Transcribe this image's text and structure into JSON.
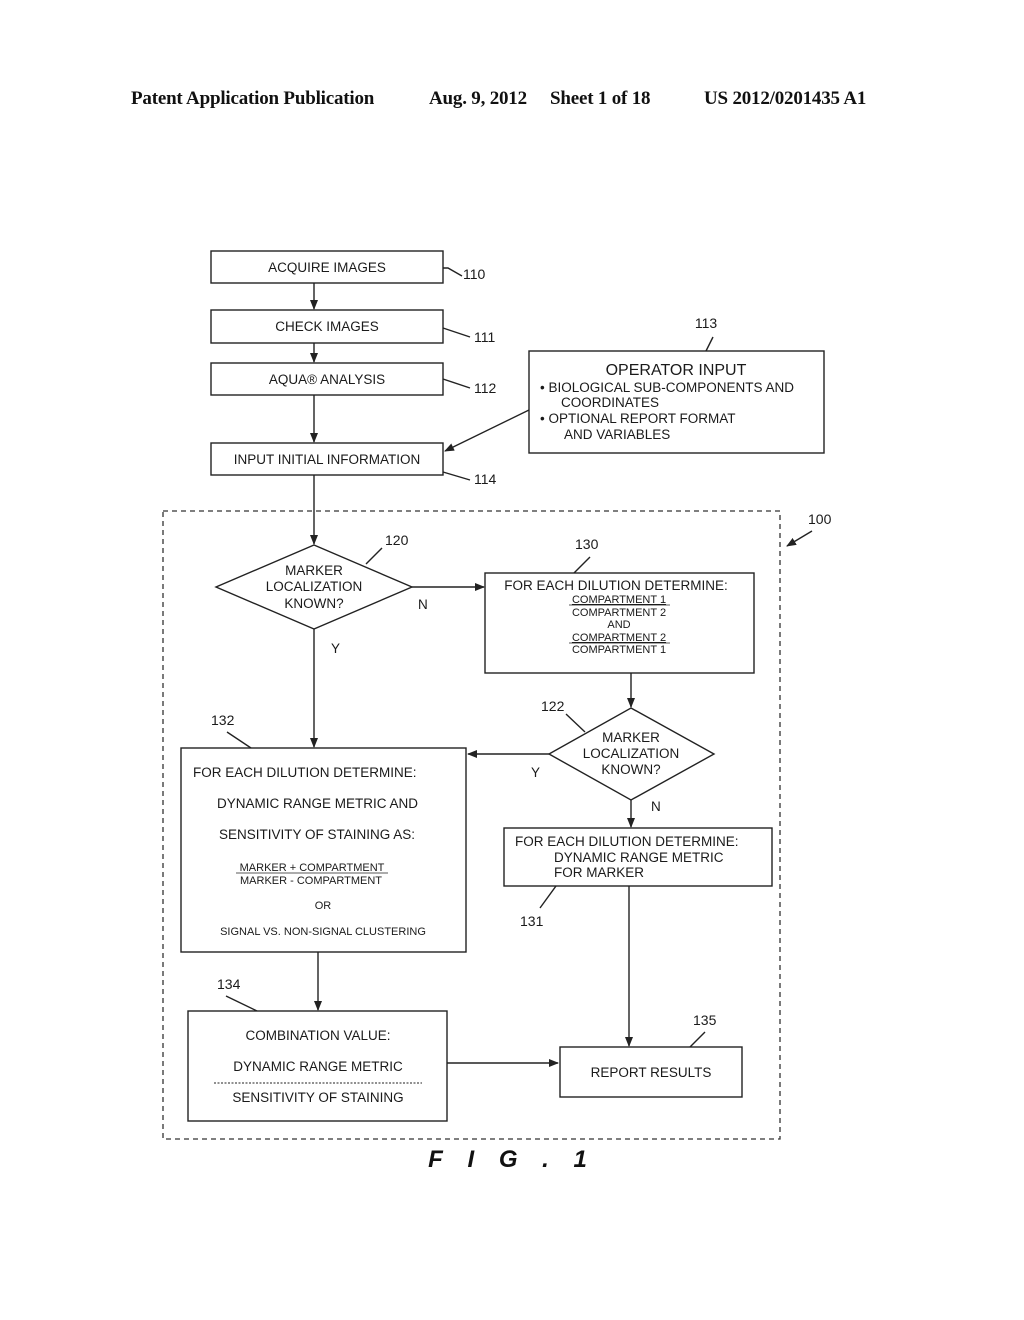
{
  "header": {
    "publication": "Patent Application Publication",
    "date": "Aug. 9, 2012",
    "sheet": "Sheet 1 of 18",
    "number": "US 2012/0201435 A1"
  },
  "figure": {
    "caption": "F I G . 1",
    "boundary_ref": "100",
    "nodes": {
      "acquire": {
        "ref": "110",
        "label": "ACQUIRE IMAGES"
      },
      "check": {
        "ref": "111",
        "label": "CHECK IMAGES"
      },
      "aqua": {
        "ref": "112",
        "label": "AQUA® ANALYSIS"
      },
      "operator": {
        "ref": "113",
        "title": "OPERATOR INPUT",
        "lines": [
          "• BIOLOGICAL SUB-COMPONENTS AND",
          "COORDINATES",
          "• OPTIONAL REPORT FORMAT",
          "AND VARIABLES"
        ]
      },
      "input_info": {
        "ref": "114",
        "label": "INPUT INITIAL INFORMATION"
      },
      "decision1": {
        "ref": "120",
        "lines": [
          "MARKER",
          "LOCALIZATION",
          "KNOWN?"
        ],
        "yes": "Y",
        "no": "N"
      },
      "compartments": {
        "ref": "130",
        "title": "FOR EACH DILUTION DETERMINE:",
        "lines": [
          "COMPARTMENT 1",
          "COMPARTMENT 2",
          "AND",
          "COMPARTMENT 2",
          "COMPARTMENT 1"
        ]
      },
      "decision2": {
        "ref": "122",
        "lines": [
          "MARKER",
          "LOCALIZATION",
          "KNOWN?"
        ],
        "yes": "Y",
        "no": "N"
      },
      "dynamic_sensitivity": {
        "ref": "132",
        "lines": [
          "FOR EACH DILUTION DETERMINE:",
          "DYNAMIC RANGE METRIC AND",
          "SENSITIVITY OF STAINING AS:"
        ],
        "fraction_num": "MARKER + COMPARTMENT",
        "fraction_den": "MARKER -  COMPARTMENT",
        "or": "OR",
        "alt": "SIGNAL VS. NON-SIGNAL CLUSTERING"
      },
      "dynamic_marker": {
        "ref": "131",
        "lines": [
          "FOR EACH DILUTION DETERMINE:",
          "DYNAMIC RANGE METRIC",
          "FOR MARKER"
        ]
      },
      "combination": {
        "ref": "134",
        "title": "COMBINATION VALUE:",
        "numerator": "DYNAMIC RANGE METRIC",
        "denominator": "SENSITIVITY OF STAINING"
      },
      "report": {
        "ref": "135",
        "label": "REPORT RESULTS"
      }
    }
  }
}
